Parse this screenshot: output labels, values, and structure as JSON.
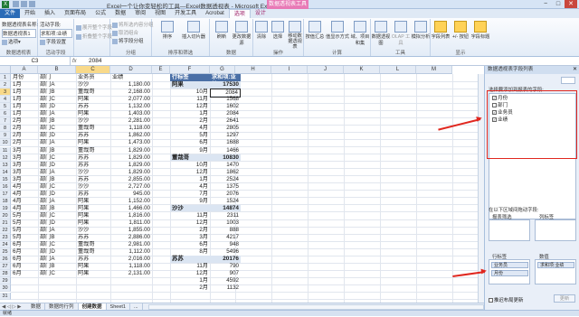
{
  "window": {
    "title": "Excel一个让你变轻松的工具—Excel数据透视表 - Microsoft Excel",
    "context_tab_group": "数据透视表工具",
    "controls": [
      "−",
      "□",
      "✕"
    ]
  },
  "ribbon_tabs": [
    "文件",
    "开始",
    "插入",
    "页面布局",
    "公式",
    "数据",
    "审阅",
    "视图",
    "开发工具",
    "Acrobat",
    "选项",
    "设计"
  ],
  "ribbon": {
    "groups": [
      {
        "label": "数据透视表",
        "items": [
          "数据透视表名称:",
          "数据透视表1",
          "选项▾"
        ]
      },
      {
        "label": "活动字段",
        "items": [
          "活动字段:",
          "求和项:业绩",
          "字段设置"
        ]
      },
      {
        "label": "",
        "items": [
          "展开整个字段",
          "折叠整个字段"
        ]
      },
      {
        "label": "分组",
        "items": [
          "将所选内容分组",
          "取消组合",
          "将字段分组"
        ]
      },
      {
        "label": "排序和筛选",
        "items": [
          "排序",
          "插入切片器"
        ]
      },
      {
        "label": "数据",
        "items": [
          "刷新",
          "更改数据源"
        ]
      },
      {
        "label": "操作",
        "items": [
          "清除",
          "选择",
          "移动数据透视表"
        ]
      },
      {
        "label": "计算",
        "items": [
          "按值汇总",
          "值显示方式",
          "域、项目和集"
        ]
      },
      {
        "label": "工具",
        "items": [
          "数据透视图",
          "OLAP 工具",
          "模拟分析"
        ]
      },
      {
        "label": "显示",
        "items": [
          "字段列表",
          "+/- 按钮",
          "字段标题"
        ]
      }
    ]
  },
  "formula_bar": {
    "name_box": "C3",
    "fx": "fx",
    "value": "2084"
  },
  "columns": [
    "A",
    "B",
    "C",
    "D",
    "E",
    "F",
    "G",
    "H",
    "I",
    "J",
    "K",
    "L",
    "M"
  ],
  "source_headers": [
    "月份",
    "部门",
    "业务员",
    "业绩"
  ],
  "source_rows": [
    [
      "1月",
      "部门A",
      "沙沙",
      "1,180.00"
    ],
    [
      "1月",
      "部门B",
      "董哉哥",
      "2,168.00"
    ],
    [
      "1月",
      "部门C",
      "阿果",
      "2,077.00"
    ],
    [
      "1月",
      "部门D",
      "苏苏",
      "1,132.00"
    ],
    [
      "1月",
      "部门A",
      "阿果",
      "1,403.00"
    ],
    [
      "2月",
      "部门B",
      "沙沙",
      "2,281.00"
    ],
    [
      "2月",
      "部门C",
      "董哉哥",
      "1,118.00"
    ],
    [
      "2月",
      "部门D",
      "苏苏",
      "1,862.00"
    ],
    [
      "2月",
      "部门A",
      "阿果",
      "1,473.00"
    ],
    [
      "3月",
      "部门B",
      "董哉哥",
      "1,829.00"
    ],
    [
      "3月",
      "部门C",
      "苏苏",
      "1,829.00"
    ],
    [
      "3月",
      "部门D",
      "苏苏",
      "1,829.00"
    ],
    [
      "3月",
      "部门A",
      "沙沙",
      "1,829.00"
    ],
    [
      "3月",
      "部门B",
      "苏苏",
      "2,855.00"
    ],
    [
      "4月",
      "部门C",
      "沙沙",
      "2,727.00"
    ],
    [
      "4月",
      "部门D",
      "苏苏",
      "945.00"
    ],
    [
      "4月",
      "部门A",
      "阿果",
      "1,152.00"
    ],
    [
      "4月",
      "部门B",
      "阿果",
      "1,466.00"
    ],
    [
      "5月",
      "部门C",
      "阿果",
      "1,816.00"
    ],
    [
      "5月",
      "部门D",
      "阿果",
      "1,811.00"
    ],
    [
      "5月",
      "部门A",
      "沙沙",
      "1,855.00"
    ],
    [
      "5月",
      "部门B",
      "苏苏",
      "2,886.00"
    ],
    [
      "6月",
      "部门C",
      "董哉哥",
      "2,981.00"
    ],
    [
      "6月",
      "部门D",
      "董哉哥",
      "1,112.00"
    ],
    [
      "6月",
      "部门A",
      "苏苏",
      "2,016.00"
    ],
    [
      "6月",
      "部门B",
      "阿果",
      "1,118.00"
    ],
    [
      "6月",
      "部门C",
      "阿果",
      "2,131.00"
    ]
  ],
  "pivot": {
    "header_row": "行标签",
    "header_value": "求和项:业绩",
    "groups": [
      {
        "name": "阿果",
        "total": "17530",
        "items": [
          [
            "10月",
            "2084"
          ],
          [
            "11月",
            "1568"
          ],
          [
            "12月",
            "1602"
          ],
          [
            "1月",
            "2084"
          ],
          [
            "2月",
            "2641"
          ],
          [
            "4月",
            "2805"
          ],
          [
            "5月",
            "1297"
          ],
          [
            "6月",
            "1688"
          ],
          [
            "9月",
            "1466"
          ]
        ]
      },
      {
        "name": "董哉哥",
        "total": "10830",
        "items": [
          [
            "10月",
            "1470"
          ],
          [
            "12月",
            "1862"
          ],
          [
            "1月",
            "2524"
          ],
          [
            "4月",
            "1375"
          ],
          [
            "7月",
            "2076"
          ],
          [
            "9月",
            "1524"
          ]
        ]
      },
      {
        "name": "沙沙",
        "total": "14874",
        "items": [
          [
            "11月",
            "2311"
          ],
          [
            "12月",
            "1003"
          ],
          [
            "2月",
            "888"
          ],
          [
            "3月",
            "4217"
          ],
          [
            "6月",
            "948"
          ],
          [
            "8月",
            "5496"
          ]
        ]
      },
      {
        "name": "苏苏",
        "total": "20176",
        "items": [
          [
            "11月",
            "790"
          ],
          [
            "12月",
            "907"
          ],
          [
            "1月",
            "4592"
          ],
          [
            "2月",
            "1132"
          ]
        ]
      }
    ]
  },
  "sheet_tabs": [
    "数据",
    "数据的行列",
    "创建数据",
    "Sheet1",
    "..."
  ],
  "active_sheet": "创建数据",
  "status": "就绪",
  "field_panel": {
    "title": "数据透视表字段列表",
    "prompt": "选择要添加到报表的字段:",
    "fields": [
      {
        "name": "月份",
        "checked": true
      },
      {
        "name": "部门",
        "checked": false
      },
      {
        "name": "业务员",
        "checked": true
      },
      {
        "name": "业绩",
        "checked": true
      }
    ],
    "drag_hint": "在以下区域间拖动字段:",
    "zone_filter": "报表筛选",
    "zone_columns": "列标签",
    "zone_rows": "行标签",
    "zone_values": "数值",
    "row_chips": [
      "业务员",
      "月份"
    ],
    "value_chips": [
      "求和项:业绩"
    ],
    "defer": "推迟布局更新",
    "update": "更新"
  },
  "colors": {
    "accent": "#4a6fa6",
    "annotation": "#e0271f",
    "context_tab": "#e87ab6"
  }
}
